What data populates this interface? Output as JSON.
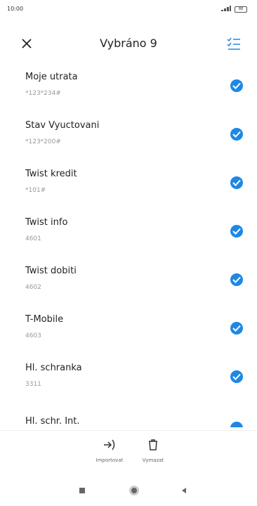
{
  "status": {
    "time": "10:00",
    "battery": "88"
  },
  "header": {
    "title": "Vybráno 9"
  },
  "items": [
    {
      "name": "Moje utrata",
      "code": "*123*234#"
    },
    {
      "name": "Stav Vyuctovani",
      "code": "*123*200#"
    },
    {
      "name": "Twist kredit",
      "code": "*101#"
    },
    {
      "name": "Twist info",
      "code": "4601"
    },
    {
      "name": "Twist dobiti",
      "code": "4602"
    },
    {
      "name": "T-Mobile",
      "code": "4603"
    },
    {
      "name": "Hl. schranka",
      "code": "3311"
    },
    {
      "name": "Hl. schr. Int.",
      "code": ""
    }
  ],
  "toolbar": {
    "import_label": "Importovat",
    "delete_label": "Vymazat"
  },
  "colors": {
    "accent": "#1e88e5"
  },
  "icons": [
    "close-icon",
    "select-all-icon",
    "checkmark-icon",
    "import-icon",
    "trash-icon",
    "recents-icon",
    "home-icon",
    "back-icon"
  ]
}
